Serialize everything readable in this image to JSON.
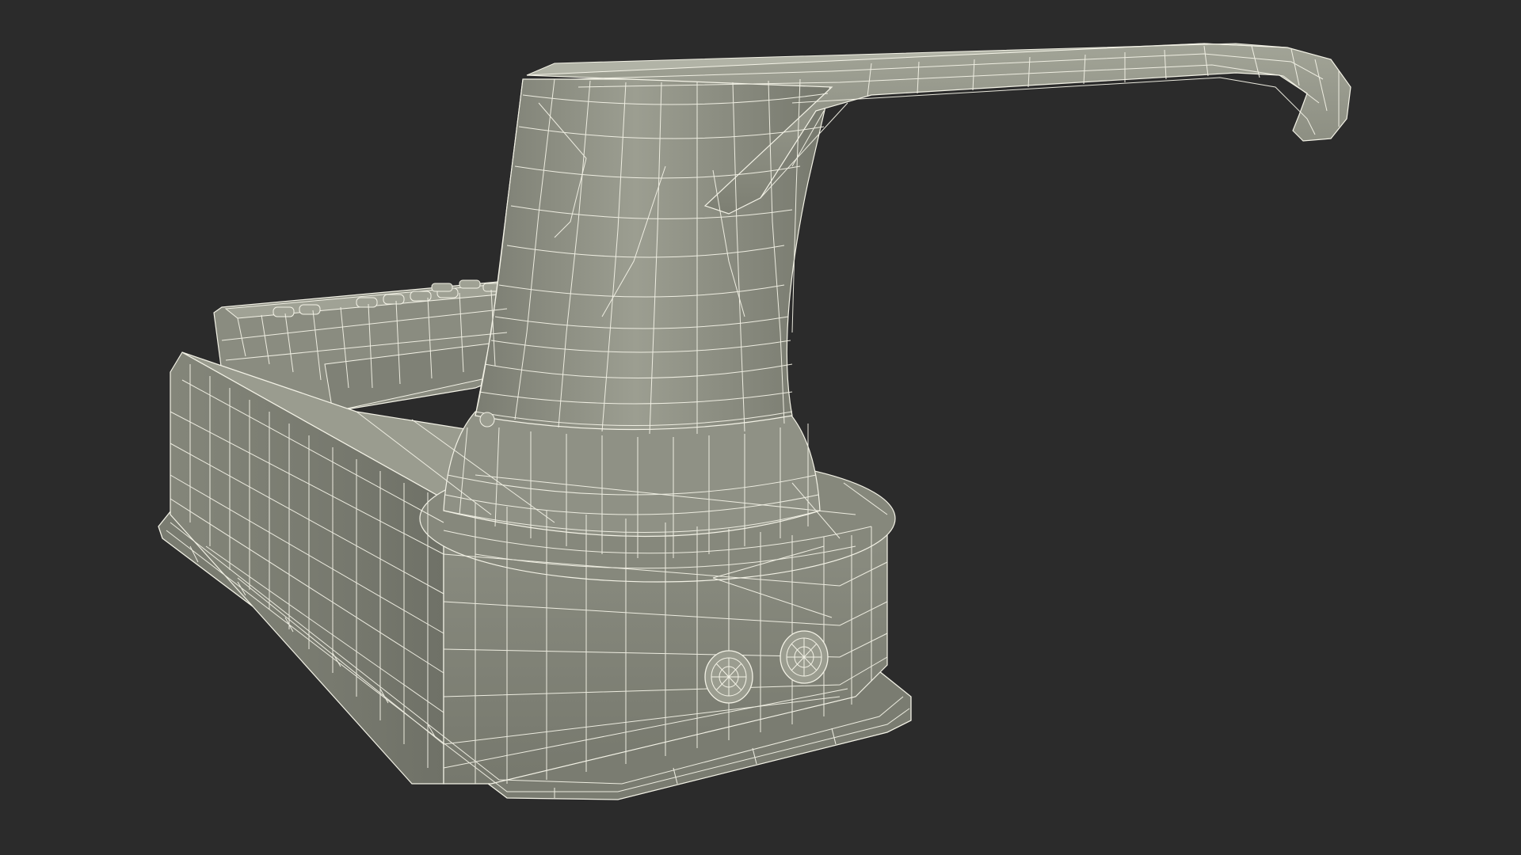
{
  "scene": {
    "subject": "lever-handle-with-keypad-wireframe",
    "colors": {
      "background": "#2b2b2b",
      "surface": "#8f9185",
      "surface_light": "#a5a79a",
      "surface_dark": "#6e7066",
      "wire": "#f3f2e6"
    }
  }
}
